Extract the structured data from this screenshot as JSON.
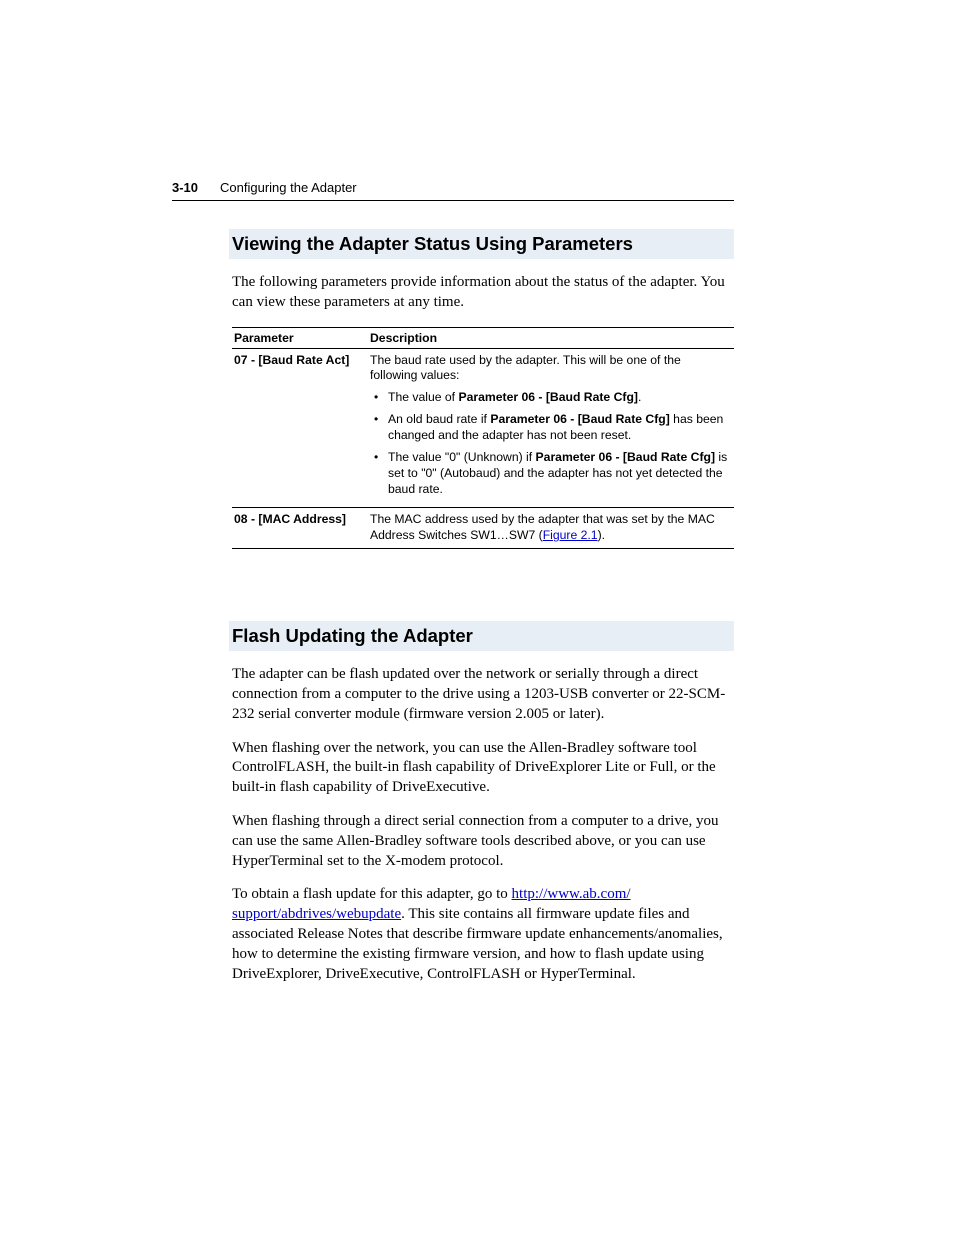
{
  "header": {
    "page_number": "3-10",
    "section": "Configuring the Adapter"
  },
  "section1": {
    "heading": "Viewing the Adapter Status Using Parameters",
    "intro": "The following parameters provide information about the status of the adapter. You can view these parameters at any time.",
    "table": {
      "col_parameter": "Parameter",
      "col_description": "Description",
      "row1": {
        "param": "07 - [Baud Rate Act]",
        "desc_intro": "The baud rate used by the adapter. This will be one of the following values:",
        "bullet1_pre": "The value of ",
        "bullet1_bold": "Parameter 06 - [Baud Rate Cfg]",
        "bullet1_post": ".",
        "bullet2_pre": "An old baud rate if ",
        "bullet2_bold": "Parameter 06 - [Baud Rate Cfg]",
        "bullet2_post": " has been changed and the adapter has not been reset.",
        "bullet3_pre": "The value \"0\" (Unknown) if ",
        "bullet3_bold": "Parameter 06 - [Baud Rate Cfg]",
        "bullet3_post": " is set to \"0\" (Autobaud) and the adapter has not yet detected the baud rate."
      },
      "row2": {
        "param": "08 - [MAC Address]",
        "desc_pre": "The MAC address used by the adapter that was set by the MAC Address Switches SW1…SW7 (",
        "link": "Figure 2.1",
        "desc_post": ")."
      }
    }
  },
  "section2": {
    "heading": "Flash Updating the Adapter",
    "para1": "The adapter can be flash updated over the network or serially through a direct connection from a computer to the drive using a 1203-USB converter or 22-SCM-232 serial converter module (firmware version 2.005 or later).",
    "para2": "When flashing over the network, you can use the Allen-Bradley software tool ControlFLASH, the built-in flash capability of DriveExplorer Lite or Full, or the built-in flash capability of DriveExecutive.",
    "para3": "When flashing through a direct serial connection from a computer to a drive, you can use the same Allen-Bradley software tools described above, or you can use HyperTerminal set to the X-modem protocol.",
    "para4_pre": "To obtain a flash update for this adapter, go to ",
    "para4_link1": "http://www.ab.com/",
    "para4_link2": "support/abdrives/webupdate",
    "para4_post": ". This site contains all firmware update files and associated Release Notes that describe firmware update enhancements/anomalies, how to determine the existing firmware version, and how to flash update using DriveExplorer, DriveExecutive, ControlFLASH or HyperTerminal."
  }
}
